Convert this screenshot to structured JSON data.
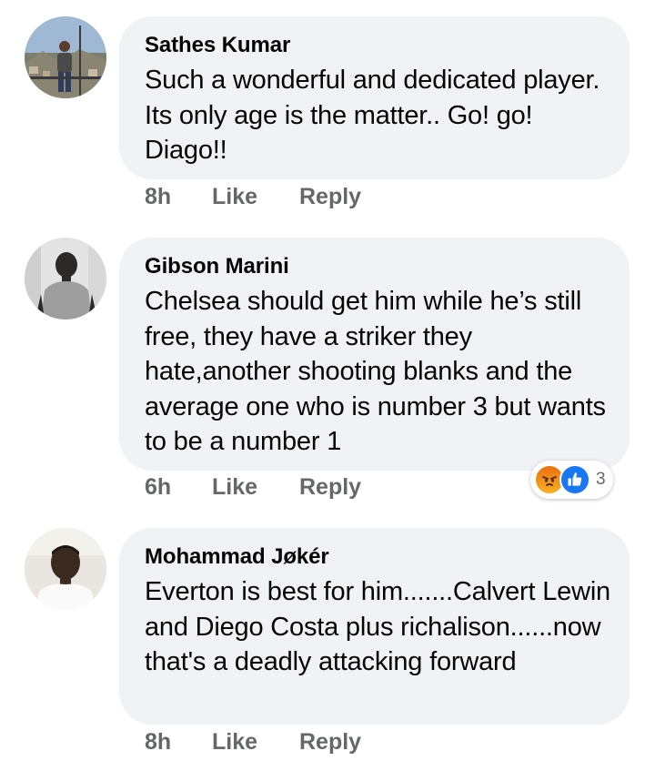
{
  "comments": [
    {
      "author": "Sathes Kumar",
      "text": "Such a wonderful and dedicated player. Its only age is the matter.. Go! go! Diago!!",
      "time": "8h",
      "like_label": "Like",
      "reply_label": "Reply"
    },
    {
      "author": "Gibson Marini",
      "text": "Chelsea should get him while he’s still free, they have a striker they hate,another shooting blanks and the average one who is number 3 but wants to be a number 1",
      "time": "6h",
      "like_label": "Like",
      "reply_label": "Reply",
      "reactions": {
        "icons": [
          "angry-icon",
          "like-thumb-icon"
        ],
        "count": "3"
      }
    },
    {
      "author": "Mohammad Jøkér",
      "text": "Everton is best for him.......Calvert Lewin and Diego Costa plus richalison......now that's a deadly attacking forward",
      "time": "8h",
      "like_label": "Like",
      "reply_label": "Reply"
    }
  ],
  "colors": {
    "bubble": "#f0f2f5",
    "meta_text": "#65676b",
    "like_blue": "#1877f2",
    "angry_orange": "#f0851a"
  }
}
